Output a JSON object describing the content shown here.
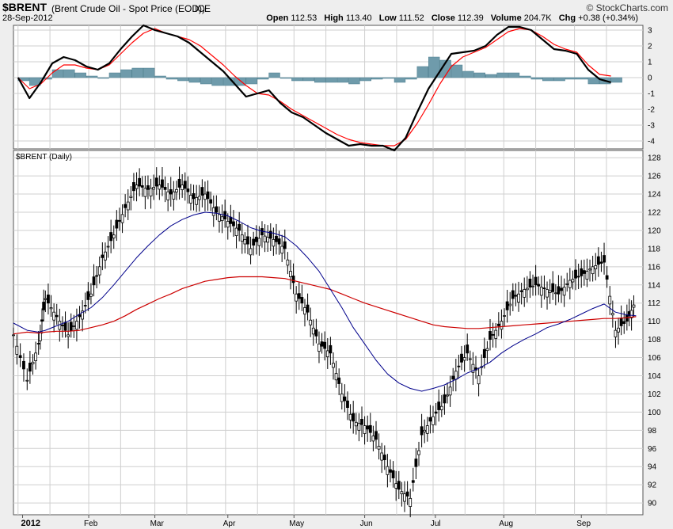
{
  "header": {
    "symbol": "$BRENT",
    "description": "(Brent Crude Oil - Spot Price (EOD))",
    "exchange": "ICE",
    "date": "28-Sep-2012",
    "brand": "© StockCharts.com",
    "open_label": "Open",
    "open": "112.53",
    "high_label": "High",
    "high": "113.40",
    "low_label": "Low",
    "low": "111.52",
    "close_label": "Close",
    "close": "112.39",
    "volume_label": "Volume",
    "volume": "204.7K",
    "chg_label": "Chg",
    "chg": "+0.38 (+0.34%)"
  },
  "colors": {
    "price_bars": "#000000",
    "ma_short": "#00008b",
    "ma_long": "#cc0000",
    "macd_line": "#000000",
    "signal_line": "#ff0000",
    "histogram": "#6f9bab",
    "grid": "#cfcfcf",
    "panel_bg": "#ffffff"
  },
  "chart_data": [
    {
      "type": "line",
      "panel": "macd",
      "yticks": [
        "3",
        "2",
        "1",
        "0",
        "-1",
        "-2",
        "-3",
        "-4"
      ],
      "ylim": [
        -4.5,
        3.3
      ],
      "grid": true,
      "x": [
        "2012-01-01",
        "2012-01-06",
        "2012-01-11",
        "2012-01-16",
        "2012-01-21",
        "2012-01-26",
        "2012-01-31",
        "2012-02-05",
        "2012-02-10",
        "2012-02-15",
        "2012-02-20",
        "2012-02-25",
        "2012-03-01",
        "2012-03-06",
        "2012-03-11",
        "2012-03-16",
        "2012-03-21",
        "2012-03-26",
        "2012-03-31",
        "2012-04-05",
        "2012-04-10",
        "2012-04-15",
        "2012-04-20",
        "2012-04-25",
        "2012-04-30",
        "2012-05-05",
        "2012-05-10",
        "2012-05-15",
        "2012-05-20",
        "2012-05-25",
        "2012-05-30",
        "2012-06-04",
        "2012-06-09",
        "2012-06-14",
        "2012-06-19",
        "2012-06-24",
        "2012-06-29",
        "2012-07-04",
        "2012-07-09",
        "2012-07-14",
        "2012-07-19",
        "2012-07-24",
        "2012-07-29",
        "2012-08-03",
        "2012-08-08",
        "2012-08-13",
        "2012-08-18",
        "2012-08-23",
        "2012-08-28",
        "2012-09-02",
        "2012-09-07",
        "2012-09-12",
        "2012-09-17",
        "2012-09-22",
        "2012-09-28"
      ],
      "series": [
        {
          "values": [
            0.0,
            -1.3,
            -0.3,
            0.9,
            1.3,
            1.1,
            0.7,
            0.5,
            0.9,
            1.8,
            2.6,
            3.3,
            3.0,
            2.8,
            2.6,
            2.2,
            1.6,
            1.0,
            0.4,
            -0.4,
            -1.2,
            -1.0,
            -0.8,
            -1.6,
            -2.2,
            -2.5,
            -3.0,
            -3.5,
            -3.9,
            -4.3,
            -4.2,
            -4.3,
            -4.3,
            -4.6,
            -3.8,
            -2.2,
            -0.7,
            0.4,
            1.5,
            1.6,
            1.7,
            2.0,
            2.7,
            3.2,
            3.2,
            3.0,
            2.4,
            1.8,
            1.7,
            1.5,
            0.5,
            -0.1,
            -0.3
          ]
        },
        {
          "values": [
            0.0,
            -0.7,
            -0.4,
            0.3,
            0.8,
            0.8,
            0.6,
            0.5,
            0.8,
            1.5,
            2.2,
            2.8,
            3.1,
            2.8,
            2.6,
            2.4,
            2.0,
            1.4,
            0.8,
            0.1,
            -0.5,
            -1.0,
            -1.1,
            -1.5,
            -2.0,
            -2.4,
            -2.8,
            -3.2,
            -3.6,
            -3.9,
            -4.1,
            -4.2,
            -4.3,
            -4.3,
            -3.9,
            -2.9,
            -1.7,
            -0.4,
            0.7,
            1.3,
            1.6,
            1.9,
            2.4,
            2.9,
            3.1,
            3.0,
            2.6,
            2.1,
            1.8,
            1.6,
            0.8,
            0.2,
            0.1
          ]
        },
        {
          "values": [
            -0.2,
            -0.5,
            -0.1,
            0.5,
            0.5,
            0.3,
            0.1,
            0.0,
            0.3,
            0.5,
            0.6,
            0.6,
            0.1,
            -0.1,
            -0.2,
            -0.3,
            -0.4,
            -0.5,
            -0.5,
            -0.5,
            -0.4,
            -0.1,
            0.3,
            0.0,
            -0.2,
            -0.2,
            -0.3,
            -0.3,
            -0.3,
            -0.4,
            -0.2,
            -0.1,
            0.0,
            -0.3,
            -0.1,
            0.7,
            1.3,
            1.1,
            0.8,
            0.4,
            0.3,
            0.2,
            0.3,
            0.3,
            0.1,
            -0.1,
            -0.2,
            -0.2,
            -0.1,
            -0.1,
            -0.4,
            -0.4,
            -0.3
          ]
        }
      ]
    },
    {
      "type": "ohlc",
      "panel": "price",
      "title": "$BRENT (Daily)",
      "yticks": [
        "128",
        "126",
        "124",
        "122",
        "120",
        "118",
        "116",
        "114",
        "112",
        "110",
        "108",
        "106",
        "104",
        "102",
        "100",
        "98",
        "96",
        "94",
        "92",
        "90"
      ],
      "ylim": [
        88.7,
        128.8
      ],
      "grid": true,
      "xlabels": [
        {
          "label": "2012",
          "date": "2012-01-03"
        },
        {
          "label": "Feb",
          "date": "2012-02-01"
        },
        {
          "label": "Mar",
          "date": "2012-03-01"
        },
        {
          "label": "Apr",
          "date": "2012-04-02"
        },
        {
          "label": "May",
          "date": "2012-05-01"
        },
        {
          "label": "Jun",
          "date": "2012-06-01"
        },
        {
          "label": "Jul",
          "date": "2012-07-02"
        },
        {
          "label": "Aug",
          "date": "2012-08-01"
        },
        {
          "label": "Sep",
          "date": "2012-09-04"
        }
      ],
      "x": [
        "2011-12-30",
        "2012-01-05",
        "2012-01-10",
        "2012-01-13",
        "2012-01-18",
        "2012-01-23",
        "2012-01-28",
        "2012-02-02",
        "2012-02-07",
        "2012-02-12",
        "2012-02-17",
        "2012-02-22",
        "2012-02-27",
        "2012-03-03",
        "2012-03-08",
        "2012-03-13",
        "2012-03-18",
        "2012-03-23",
        "2012-03-28",
        "2012-04-02",
        "2012-04-07",
        "2012-04-12",
        "2012-04-17",
        "2012-04-22",
        "2012-04-27",
        "2012-05-02",
        "2012-05-07",
        "2012-05-12",
        "2012-05-17",
        "2012-05-22",
        "2012-05-27",
        "2012-06-01",
        "2012-06-06",
        "2012-06-11",
        "2012-06-16",
        "2012-06-21",
        "2012-06-26",
        "2012-07-01",
        "2012-07-06",
        "2012-07-11",
        "2012-07-16",
        "2012-07-21",
        "2012-07-26",
        "2012-07-31",
        "2012-08-05",
        "2012-08-10",
        "2012-08-15",
        "2012-08-20",
        "2012-08-25",
        "2012-08-30",
        "2012-09-04",
        "2012-09-09",
        "2012-09-14",
        "2012-09-19",
        "2012-09-24",
        "2012-09-28"
      ],
      "series": [
        {
          "name": "close",
          "values": [
            108.5,
            103.5,
            107.5,
            112.5,
            110.5,
            108.5,
            110.5,
            113.0,
            117.0,
            119.5,
            122.5,
            125.0,
            124.5,
            125.0,
            124.0,
            125.0,
            123.5,
            124.0,
            122.0,
            121.0,
            120.0,
            118.0,
            119.5,
            119.0,
            118.0,
            113.0,
            111.0,
            107.5,
            106.5,
            102.0,
            99.0,
            98.5,
            97.0,
            94.0,
            91.5,
            90.5,
            97.5,
            99.5,
            101.0,
            104.5,
            106.5,
            104.0,
            108.0,
            110.0,
            112.5,
            113.5,
            114.0,
            113.5,
            113.0,
            114.5,
            115.0,
            116.0,
            116.5,
            109.0,
            110.0,
            112.39
          ]
        },
        {
          "name": "MA 50",
          "values": [
            109.8,
            109.0,
            108.8,
            109.0,
            109.5,
            110.0,
            110.8,
            111.5,
            112.6,
            114.0,
            115.5,
            117.0,
            118.3,
            119.5,
            120.5,
            121.2,
            121.7,
            122.0,
            121.9,
            121.6,
            121.0,
            120.3,
            119.9,
            119.7,
            119.3,
            118.3,
            117.0,
            115.5,
            113.5,
            111.5,
            109.3,
            107.5,
            105.7,
            104.2,
            103.2,
            102.6,
            102.3,
            102.6,
            103.0,
            103.6,
            104.3,
            104.8,
            105.5,
            106.5,
            107.3,
            108.0,
            108.6,
            109.3,
            109.7,
            110.2,
            110.8,
            111.4,
            111.9,
            111.0,
            110.7,
            110.6
          ]
        },
        {
          "name": "MA 200",
          "values": [
            108.6,
            108.8,
            108.7,
            108.8,
            108.9,
            108.9,
            109.0,
            109.3,
            109.6,
            110.0,
            110.6,
            111.3,
            111.9,
            112.5,
            113.0,
            113.6,
            114.0,
            114.4,
            114.6,
            114.8,
            114.9,
            114.9,
            114.9,
            114.8,
            114.7,
            114.4,
            114.1,
            113.8,
            113.5,
            113.0,
            112.5,
            112.0,
            111.6,
            111.2,
            110.8,
            110.4,
            110.0,
            109.6,
            109.4,
            109.3,
            109.2,
            109.2,
            109.3,
            109.4,
            109.5,
            109.6,
            109.7,
            109.8,
            109.9,
            110.0,
            110.1,
            110.2,
            110.3,
            110.3,
            110.4,
            110.5
          ]
        }
      ]
    }
  ]
}
